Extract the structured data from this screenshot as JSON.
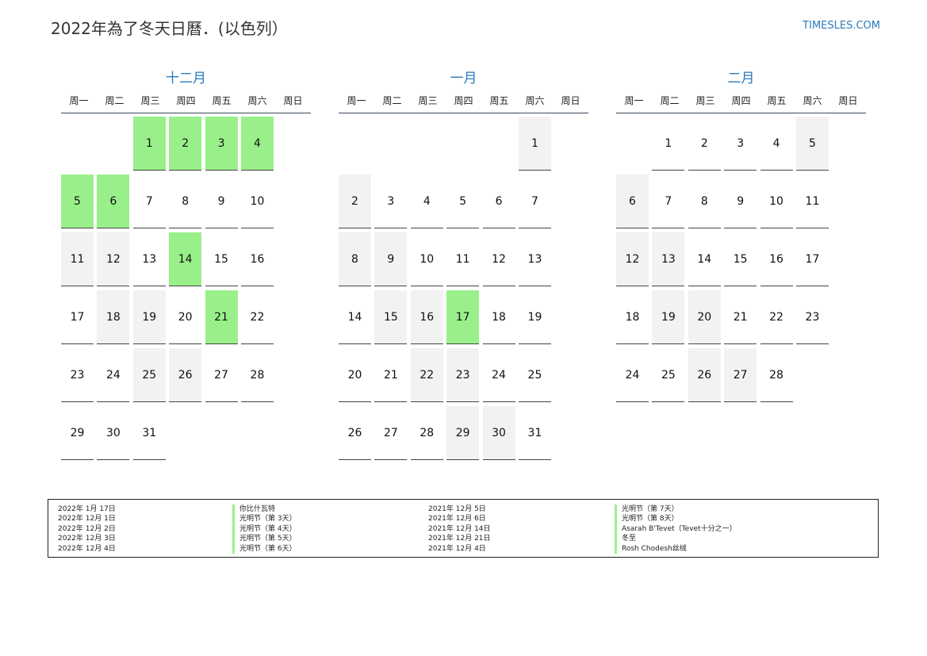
{
  "header": {
    "title": "2022年為了冬天日曆．(以色列）",
    "site": "TIMESLES.COM"
  },
  "weekdays": [
    "周一",
    "周二",
    "周三",
    "周四",
    "周五",
    "周六",
    "周日"
  ],
  "months": [
    {
      "name": "十二月",
      "offset": 2,
      "days": 31,
      "weekend_cols": [
        5,
        6
      ],
      "holidays": [
        1,
        2,
        3,
        4,
        5,
        6,
        14,
        21
      ]
    },
    {
      "name": "一月",
      "offset": 5,
      "days": 31,
      "weekend_cols": [
        5,
        6
      ],
      "holidays": [
        17
      ]
    },
    {
      "name": "二月",
      "offset": 1,
      "days": 28,
      "weekend_cols": [
        5,
        6
      ],
      "holidays": []
    }
  ],
  "legend": {
    "col1_dates": [
      "2022年 1月 17日",
      "2022年 12月 1日",
      "2022年 12月 2日",
      "2022年 12月 3日",
      "2022年 12月 4日"
    ],
    "col1_names": [
      "你比什瓦特",
      "光明节（第 3天）",
      "光明节（第 4天）",
      "光明节（第 5天）",
      "光明节（第 6天）"
    ],
    "col2_dates": [
      "2021年 12月 5日",
      "2021年 12月 6日",
      "2021年 12月 14日",
      "2021年 12月 21日",
      "2021年 12月 4日"
    ],
    "col2_names": [
      "光明节（第 7天）",
      "光明节（第 8天）",
      "Asarah B'Tevet（Tevet十分之一）",
      "冬至",
      "Rosh Chodesh丝绒"
    ]
  }
}
